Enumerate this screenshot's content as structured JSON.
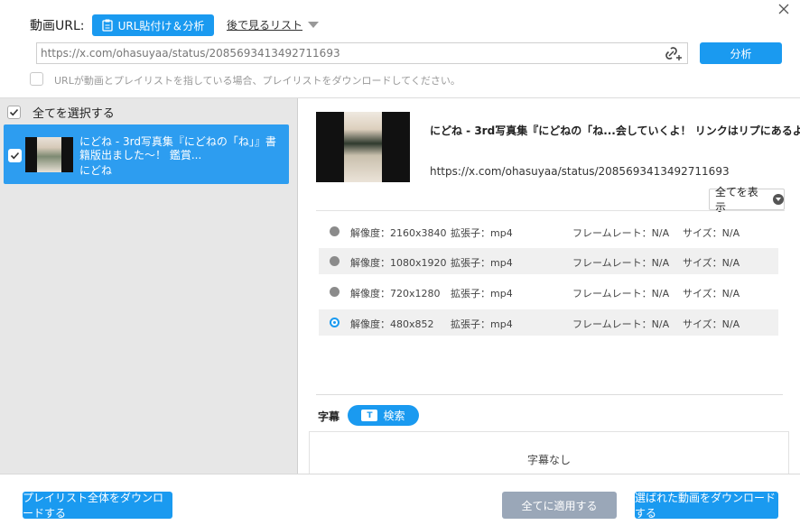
{
  "toolbar": {
    "url_label": "動画URL:",
    "paste_button": "URL貼付け＆分析",
    "watch_later": "後で見るリスト",
    "url_value": "https://x.com/ohasuyaa/status/2085693413492711693",
    "analyze_button": "分析",
    "playlist_note": "URLが動画とプレイリストを指している場合、プレイリストをダウンロードしてください。"
  },
  "left": {
    "select_all": "全てを選択する",
    "items": [
      {
        "title": "にどね - 3rd写真集『にどねの「ね」』書籍版出ました～！ 鑑賞...",
        "author": "にどね",
        "checked": true
      }
    ]
  },
  "detail": {
    "title": "にどね - 3rd写真集『にどねの「ね...会していくよ！ リンクはリプにあるよ",
    "url": "https://x.com/ohasuyaa/status/2085693413492711693",
    "show_all": "全てを表示",
    "formats": [
      {
        "res": "解像度：2160x3840",
        "ext": "拡張子：mp4",
        "fps": "フレームレート：N/A",
        "size": "サイズ：N/A",
        "selected": false
      },
      {
        "res": "解像度：1080x1920",
        "ext": "拡張子：mp4",
        "fps": "フレームレート：N/A",
        "size": "サイズ：N/A",
        "selected": false
      },
      {
        "res": "解像度：720x1280",
        "ext": "拡張子：mp4",
        "fps": "フレームレート：N/A",
        "size": "サイズ：N/A",
        "selected": false
      },
      {
        "res": "解像度：480x852",
        "ext": "拡張子：mp4",
        "fps": "フレームレート：N/A",
        "size": "サイズ：N/A",
        "selected": true
      }
    ],
    "subtitle_label": "字幕",
    "search_button": "検索",
    "no_subtitles": "字幕なし"
  },
  "bottom": {
    "playlist_download": "プレイリスト全体をダウンロードする",
    "apply_all": "全てに適用する",
    "download_selected": "選ばれた動画をダウンロードする"
  },
  "colors": {
    "accent": "#1a9af0",
    "selected_item": "#2d9df0",
    "disabled_button": "#9aa7b8",
    "left_panel_bg": "#e7e7e7"
  }
}
